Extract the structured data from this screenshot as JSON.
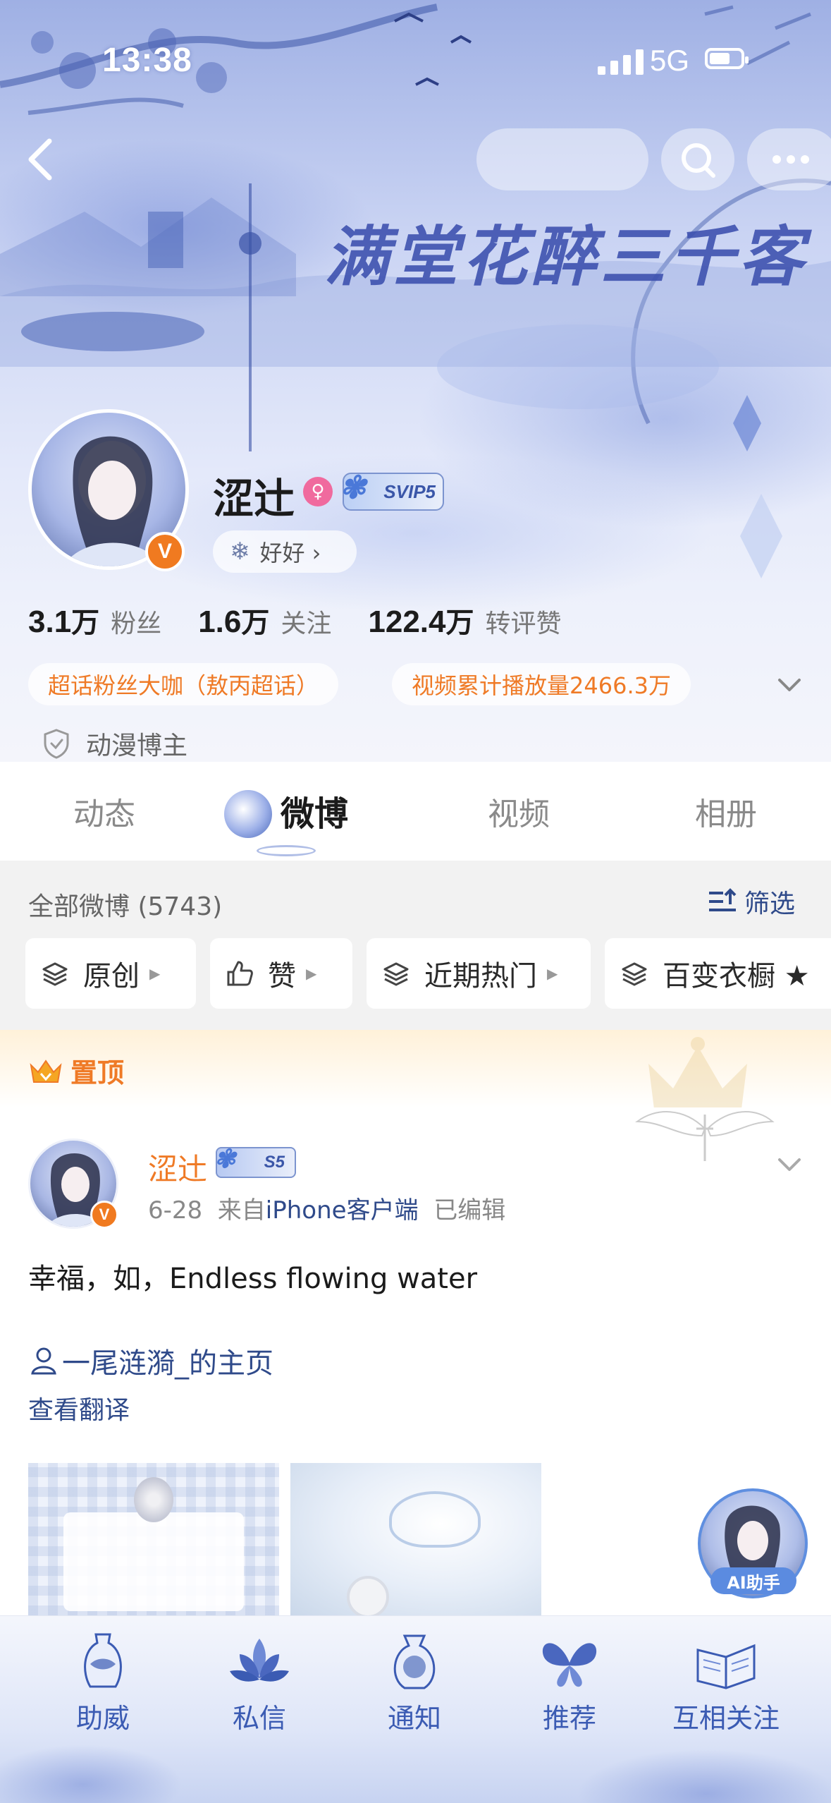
{
  "status_bar": {
    "time": "13:38",
    "network": "5G"
  },
  "banner": {
    "title": "满堂花醉三千客"
  },
  "profile": {
    "nickname": "涩辻",
    "vip_badge": "SVIP5",
    "follow_tag": "好好 ›",
    "stats": [
      {
        "num": "3.1",
        "unit": "万",
        "label": "粉丝"
      },
      {
        "num": "1.6",
        "unit": "万",
        "label": "关注"
      },
      {
        "num": "122.4",
        "unit": "万",
        "label": "转评赞"
      }
    ],
    "pills": [
      "超话粉丝大咖（敖丙超话）",
      "视频累计播放量2466.3万"
    ],
    "category": "动漫博主"
  },
  "tabs": [
    {
      "label": "动态",
      "active": false
    },
    {
      "label": "微博",
      "active": true
    },
    {
      "label": "视频",
      "active": false
    },
    {
      "label": "相册",
      "active": false
    }
  ],
  "filter": {
    "all_label": "全部微博 (5743)",
    "filter_label": "筛选",
    "chips": [
      "原创",
      "赞",
      "近期热门",
      "百变衣橱 ★"
    ]
  },
  "pinned": {
    "label": "置顶"
  },
  "post": {
    "author": "涩辻",
    "badge": "S5",
    "date": "6-28",
    "from_prefix": "来自",
    "source": "iPhone客户端",
    "edited": "已编辑",
    "text": "幸福，如，Endless flowing water",
    "link": "一尾涟漪_的主页",
    "translate": "查看翻译"
  },
  "ai_helper": {
    "label": "AI助手"
  },
  "bottom_nav": [
    {
      "label": "助威",
      "icon": "vase-icon"
    },
    {
      "label": "私信",
      "icon": "lotus-icon"
    },
    {
      "label": "通知",
      "icon": "pouch-icon"
    },
    {
      "label": "推荐",
      "icon": "butterfly-icon"
    },
    {
      "label": "互相关注",
      "icon": "book-icon"
    }
  ],
  "colors": {
    "accent_orange": "#ef7a26",
    "link_blue": "#2f4a8a",
    "theme_blue": "#3b5bb3"
  }
}
